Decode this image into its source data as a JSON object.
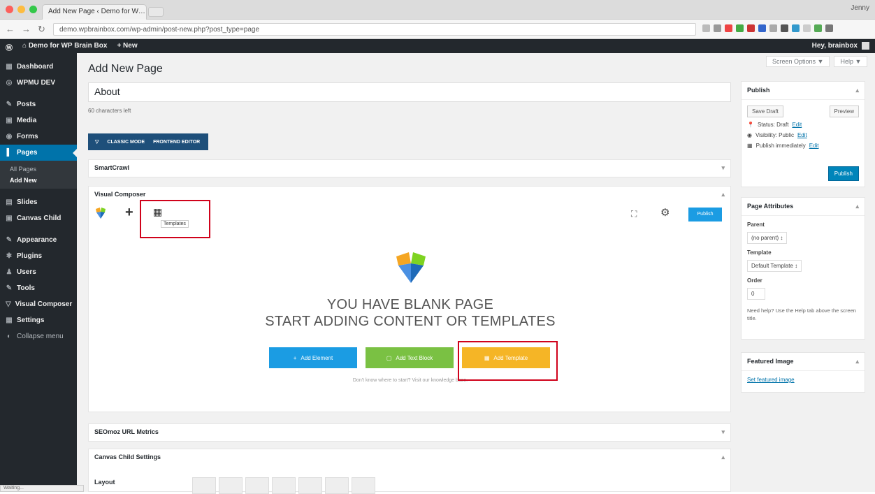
{
  "browser": {
    "tab_title": "Add New Page ‹ Demo for W… ✕",
    "url": "demo.wpbrainbox.com/wp-admin/post-new.php?post_type=page",
    "user": "Jenny"
  },
  "adminbar": {
    "site": "Demo for WP Brain Box",
    "new": "+ New",
    "howdy": "Hey, brainbox"
  },
  "sidebar": {
    "items": [
      {
        "icon": "▦",
        "label": "Dashboard"
      },
      {
        "icon": "◎",
        "label": "WPMU DEV"
      },
      {
        "icon": "✎",
        "label": "Posts"
      },
      {
        "icon": "▣",
        "label": "Media"
      },
      {
        "icon": "◉",
        "label": "Forms"
      },
      {
        "icon": "▌",
        "label": "Pages"
      }
    ],
    "submenu": [
      "All Pages",
      "Add New"
    ],
    "items2": [
      {
        "icon": "▤",
        "label": "Slides"
      },
      {
        "icon": "▣",
        "label": "Canvas Child"
      },
      {
        "icon": "✎",
        "label": "Appearance"
      },
      {
        "icon": "✱",
        "label": "Plugins"
      },
      {
        "icon": "♟",
        "label": "Users"
      },
      {
        "icon": "✎",
        "label": "Tools"
      },
      {
        "icon": "▽",
        "label": "Visual Composer"
      },
      {
        "icon": "▦",
        "label": "Settings"
      },
      {
        "icon": "◐",
        "label": "Collapse menu"
      }
    ]
  },
  "main": {
    "screen_options": "Screen Options ▼",
    "help": "Help ▼",
    "page_title": "Add New Page",
    "title_value": "About",
    "permalink": "60 characters left",
    "vc_switch": {
      "classic": "CLASSIC MODE",
      "frontend": "FRONTEND EDITOR"
    },
    "smartcrawl": "SmartCrawl",
    "visual_composer": "Visual Composer",
    "tooltip": "Templates",
    "update_btn": "Publish",
    "blank_line1": "YOU HAVE BLANK PAGE",
    "blank_line2": "START ADDING CONTENT OR TEMPLATES",
    "btn_add_element": "Add Element",
    "btn_add_text": "Add Text Block",
    "btn_add_template": "Add Template",
    "helpline": "Don't know where to start? Visit our knowledge base.",
    "seomoz": "SEOmoz URL Metrics",
    "canvas_settings": "Canvas Child Settings",
    "layout_label": "Layout"
  },
  "publish": {
    "title": "Publish",
    "save_draft": "Save Draft",
    "preview": "Preview",
    "status": "Status: Draft",
    "visibility": "Visibility: Public",
    "publish_time": "Publish immediately",
    "edit": "Edit",
    "publish_btn": "Publish"
  },
  "page_attributes": {
    "title": "Page Attributes",
    "parent_label": "Parent",
    "parent_value": "(no parent) ↕",
    "template_label": "Template",
    "template_value": "Default Template ↕",
    "order_label": "Order",
    "order_value": "0",
    "help": "Need help? Use the Help tab above the screen title."
  },
  "featured": {
    "title": "Featured Image",
    "link": "Set featured image"
  },
  "statusbar": "Waiting..."
}
